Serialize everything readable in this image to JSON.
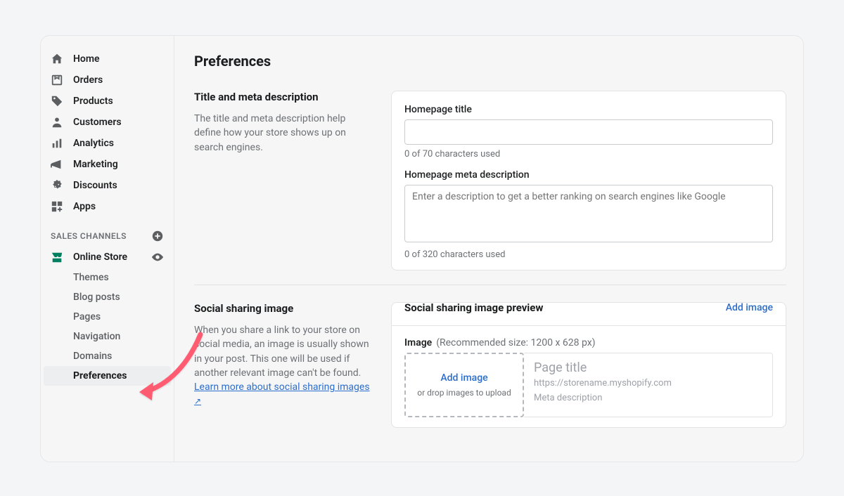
{
  "sidebar": {
    "items": [
      {
        "label": "Home",
        "icon": "home"
      },
      {
        "label": "Orders",
        "icon": "orders"
      },
      {
        "label": "Products",
        "icon": "products"
      },
      {
        "label": "Customers",
        "icon": "customers"
      },
      {
        "label": "Analytics",
        "icon": "analytics"
      },
      {
        "label": "Marketing",
        "icon": "marketing"
      },
      {
        "label": "Discounts",
        "icon": "discounts"
      },
      {
        "label": "Apps",
        "icon": "apps"
      }
    ],
    "channels_heading": "SALES CHANNELS",
    "online_store": "Online Store",
    "sub": [
      {
        "label": "Themes"
      },
      {
        "label": "Blog posts"
      },
      {
        "label": "Pages"
      },
      {
        "label": "Navigation"
      },
      {
        "label": "Domains"
      },
      {
        "label": "Preferences",
        "active": true
      }
    ]
  },
  "page": {
    "title": "Preferences"
  },
  "meta": {
    "heading": "Title and meta description",
    "desc": "The title and meta description help define how your store shows up on search engines.",
    "title_label": "Homepage title",
    "title_value": "",
    "title_helper": "0 of 70 characters used",
    "desc_label": "Homepage meta description",
    "desc_placeholder": "Enter a description to get a better ranking on search engines like Google",
    "desc_helper": "0 of 320 characters used"
  },
  "social": {
    "heading": "Social sharing image",
    "desc": "When you share a link to your store on social media, an image is usually shown in your post. This one will be used if another relevant image can't be found. ",
    "learn_more": "Learn more about social sharing images",
    "card_title": "Social sharing image preview",
    "add_image": "Add image",
    "image_label": "Image",
    "rec": "(Recommended size: 1200 x 628 px)",
    "drop_add": "Add image",
    "drop_hint": "or drop images to upload",
    "preview_title": "Page title",
    "preview_url": "https://storename.myshopify.com",
    "preview_meta": "Meta description"
  }
}
